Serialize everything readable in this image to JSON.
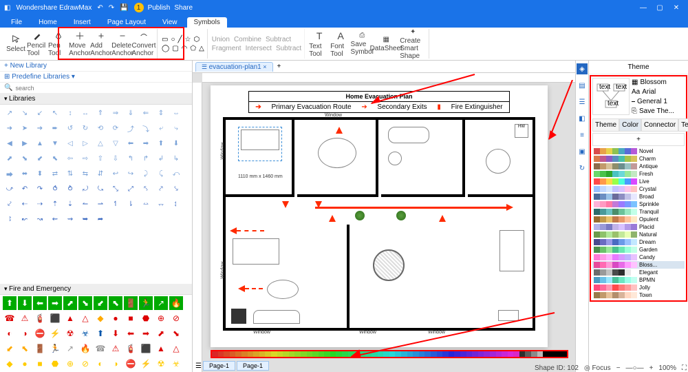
{
  "app": {
    "title": "Wondershare EdrawMax",
    "publish": "Publish",
    "share": "Share"
  },
  "menu": {
    "file": "File",
    "home": "Home",
    "insert": "Insert",
    "page_layout": "Page Layout",
    "view": "View",
    "symbols": "Symbols"
  },
  "ribbon": {
    "select": "Select",
    "pencil": "Pencil Tool",
    "pen": "Pen Tool",
    "move": "Move Anchor",
    "add": "Add Anchor",
    "delete": "Delete Anchor",
    "convert": "Convert Anchor",
    "union": "Union",
    "combine": "Combine",
    "subtract": "Subtract",
    "fragment": "Fragment",
    "intersect": "Intersect",
    "subtract2": "Subtract",
    "text": "Text Tool",
    "font": "Font Tool",
    "save": "Save Symbol",
    "datasheet": "DataSheet",
    "smart": "Create Smart Shape"
  },
  "left": {
    "new_library": "New Library",
    "predefine": "Predefine Libraries",
    "search_ph": "search",
    "libraries": "Libraries",
    "fire": "Fire and Emergency"
  },
  "doc": {
    "tab": "evacuation-plan1",
    "page1": "Page-1",
    "title": "Home Evacuation Plan",
    "primary": "Primary Evacuation Route",
    "secondary": "Secondary Exits",
    "ext": "Fire Extinguisher",
    "dim": "1110 mm x 1460 mm",
    "window": "Window"
  },
  "theme": {
    "header": "Theme",
    "blossom": "Blossom",
    "arial": "Arial",
    "general": "General 1",
    "save": "Save The...",
    "t_theme": "Theme",
    "t_color": "Color",
    "t_connector": "Connector",
    "t_text": "Text",
    "names": [
      "Novel",
      "Charm",
      "Antique",
      "Fresh",
      "Live",
      "Crystal",
      "Broad",
      "Sprinkle",
      "Tranquil",
      "Opulent",
      "Placid",
      "Natural",
      "Dream",
      "Garden",
      "Candy",
      "Bloss...",
      "Elegant",
      "BPMN",
      "Jolly",
      "Town"
    ],
    "rows": [
      [
        "#d94c4c",
        "#e8a24a",
        "#e8d34a",
        "#8ec252",
        "#4aa8c2",
        "#5a6bd8",
        "#b55ad8"
      ],
      [
        "#d97a4c",
        "#c25a8e",
        "#8e5ac2",
        "#5a8ec2",
        "#4ac2a8",
        "#a8c24a",
        "#d8c25a"
      ],
      [
        "#8e6b4a",
        "#c29a6b",
        "#d8c29a",
        "#8e8e6b",
        "#6b8e8e",
        "#9ac2c2",
        "#c29a9a"
      ],
      [
        "#6bd86b",
        "#4ac24a",
        "#2da82d",
        "#4ac2c2",
        "#6bd8d8",
        "#9ae89a",
        "#c2e8c2"
      ],
      [
        "#ff4a4a",
        "#ff9a4a",
        "#ffd84a",
        "#9aff4a",
        "#4affd8",
        "#4a9aff",
        "#d84aff"
      ],
      [
        "#9ac2ff",
        "#c2d8ff",
        "#d8e8ff",
        "#c2c2ff",
        "#d8c2ff",
        "#ffc2e8",
        "#ffc2c2"
      ],
      [
        "#4a6b9a",
        "#6b8ec2",
        "#9ac2e8",
        "#6b6b9a",
        "#8e8ec2",
        "#c2c2e8",
        "#e8e8ff"
      ],
      [
        "#ffb3d8",
        "#ff9ac2",
        "#ff7aa8",
        "#c27ad8",
        "#9a7aff",
        "#7a9aff",
        "#7ac2ff"
      ],
      [
        "#2d6b6b",
        "#4a9a9a",
        "#6bc2c2",
        "#4a8e6b",
        "#6bc29a",
        "#9ae8c2",
        "#c2ffe8"
      ],
      [
        "#9a6b2d",
        "#c29a4a",
        "#e8c26b",
        "#c27a4a",
        "#e89a6b",
        "#ffc29a",
        "#ffe8c2"
      ],
      [
        "#b3b3e8",
        "#9a9ad8",
        "#7a7ac2",
        "#c2b3e8",
        "#d8c2ff",
        "#b39ae8",
        "#9a7ad8"
      ],
      [
        "#6b9a4a",
        "#8ec26b",
        "#b3e89a",
        "#9ac26b",
        "#c2e89a",
        "#e8ffb3",
        "#8eb36b"
      ],
      [
        "#4a4a8e",
        "#6b6bc2",
        "#9a9ae8",
        "#4a6bc2",
        "#6b9ae8",
        "#9ac2ff",
        "#c2e8ff"
      ],
      [
        "#4a8e4a",
        "#6bc26b",
        "#9ae89a",
        "#4ac28e",
        "#6be8b3",
        "#9affd8",
        "#c2ffe8"
      ],
      [
        "#ff7ad8",
        "#ff9ae8",
        "#ffb3ff",
        "#e87aff",
        "#d89aff",
        "#c2b3ff",
        "#e8c2ff"
      ],
      [
        "#e84a9a",
        "#ff6bb3",
        "#ff9ad8",
        "#d84ac2",
        "#e86be8",
        "#ff9aff",
        "#ffc2ff"
      ],
      [
        "#6b6b6b",
        "#9a9a9a",
        "#c2c2c2",
        "#4a4a4a",
        "#2d2d2d",
        "#e8e8e8",
        "#ffffff"
      ],
      [
        "#4a9ac2",
        "#6bc2e8",
        "#9ae8ff",
        "#4ac29a",
        "#6be8c2",
        "#9affe8",
        "#c2fff0"
      ],
      [
        "#ff4a7a",
        "#ff6b9a",
        "#ff9ab3",
        "#ff4a4a",
        "#ff7a7a",
        "#ff9a9a",
        "#ffc2c2"
      ],
      [
        "#9a7a4a",
        "#c29a6b",
        "#e8c29a",
        "#b38e6b",
        "#d8b39a",
        "#ffd8c2",
        "#ffe8d8"
      ]
    ]
  },
  "status": {
    "shapeid": "Shape ID: 102",
    "focus": "Focus",
    "zoom": "100%"
  },
  "colorbar": [
    "#8b0000",
    "#a52a2a",
    "#d2691e",
    "#ff8c00",
    "#ffa500",
    "#ffd700",
    "#ffff00",
    "#adff2f",
    "#7cfc00",
    "#32cd32",
    "#228b22",
    "#008000",
    "#20b2aa",
    "#00ced1",
    "#00bfff",
    "#1e90ff",
    "#4169e1",
    "#0000cd",
    "#4b0082",
    "#8a2be2",
    "#9932cc",
    "#ba55d3",
    "#ff00ff",
    "#ff1493",
    "#dc143c",
    "#b22222",
    "#696969",
    "#808080",
    "#a9a9a9",
    "#c0c0c0",
    "#d3d3d3",
    "#2f4f4f",
    "#000000",
    "#ffffff"
  ]
}
